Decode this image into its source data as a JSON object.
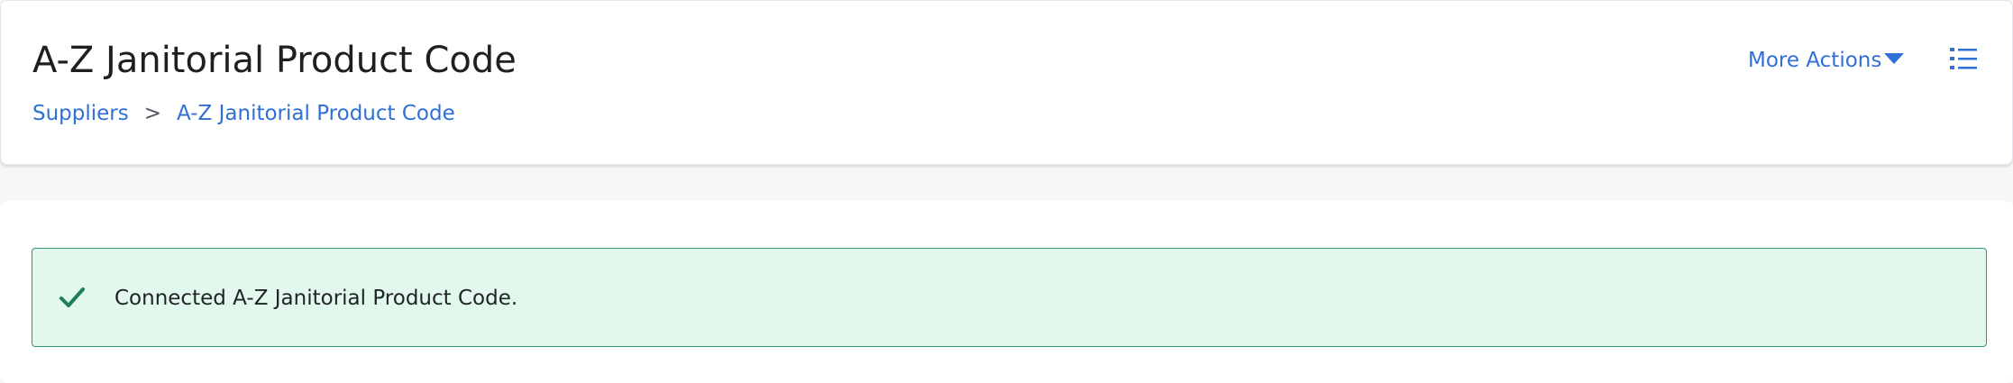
{
  "header": {
    "title": "A-Z Janitorial Product Code",
    "breadcrumb": [
      {
        "label": "Suppliers"
      },
      {
        "label": "A-Z Janitorial Product Code"
      }
    ],
    "breadcrumb_separator": ">",
    "more_actions_label": "More Actions",
    "more_actions_icon": "caret-down-icon",
    "list_button_icon": "list-icon"
  },
  "alert": {
    "type": "success",
    "icon": "check-icon",
    "message": "Connected A-Z Janitorial Product Code."
  },
  "colors": {
    "link": "#2f6fd6",
    "success_bg": "#e2f8ed",
    "success_border": "#2f9a70",
    "success_icon": "#1f7f5c"
  }
}
